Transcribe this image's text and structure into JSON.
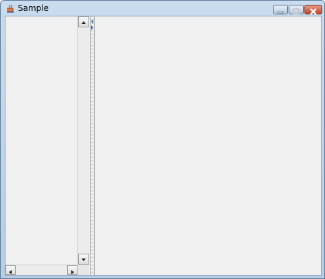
{
  "window": {
    "title": "Sample",
    "icons": {
      "app": "java-app-icon",
      "minimize": "minimize-icon",
      "maximize": "maximize-icon",
      "close": "close-icon"
    },
    "colors": {
      "titlebar": "#c9dcee",
      "close_button": "#c6432b",
      "pane_background": "#f0f0f0"
    }
  },
  "split_pane": {
    "divider_arrows": [
      "collapse-left-icon",
      "expand-right-icon"
    ]
  },
  "scrollbars": {
    "vertical_icons": [
      "scroll-up-arrow-icon",
      "scroll-down-arrow-icon"
    ],
    "horizontal_icons": [
      "scroll-left-arrow-icon",
      "scroll-right-arrow-icon"
    ]
  }
}
